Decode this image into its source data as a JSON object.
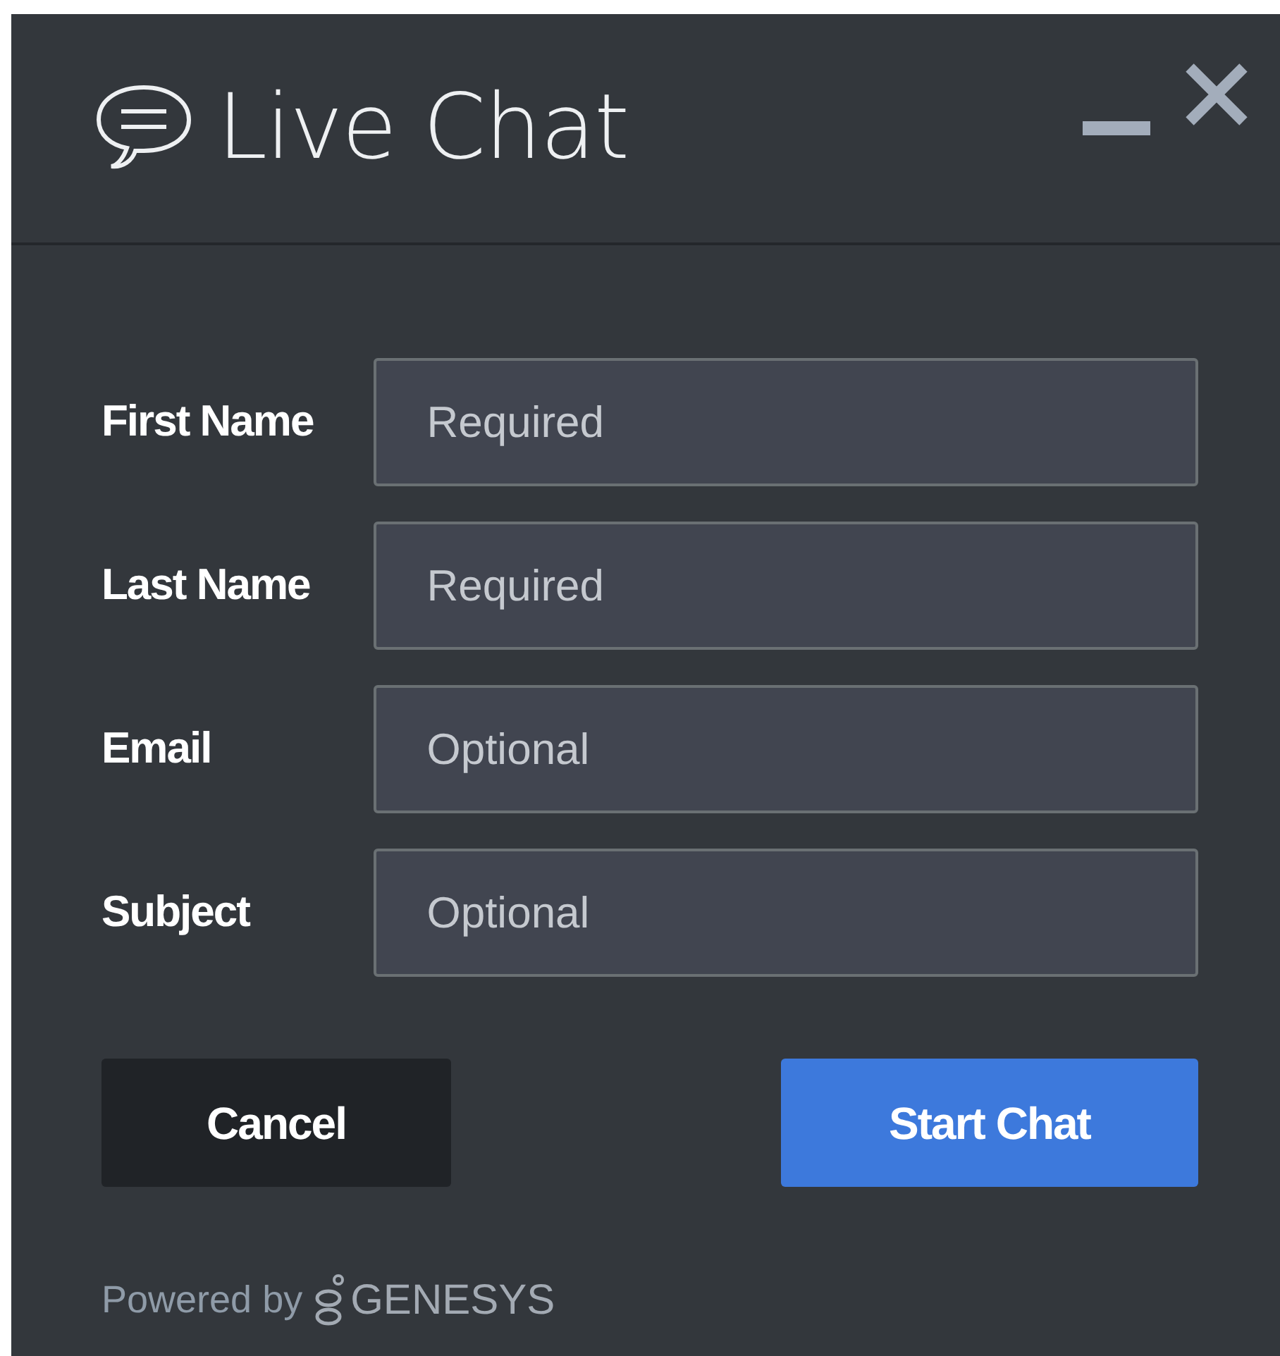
{
  "window": {
    "title": "Live Chat"
  },
  "fields": [
    {
      "label": "First Name",
      "placeholder": "Required"
    },
    {
      "label": "Last Name",
      "placeholder": "Required"
    },
    {
      "label": "Email",
      "placeholder": "Optional"
    },
    {
      "label": "Subject",
      "placeholder": "Optional"
    }
  ],
  "buttons": [
    {
      "label": "Cancel",
      "kind": "secondary"
    },
    {
      "label": "Start Chat",
      "kind": "primary"
    }
  ],
  "footer": {
    "text": "Powered by",
    "brand": "GENESYS"
  }
}
